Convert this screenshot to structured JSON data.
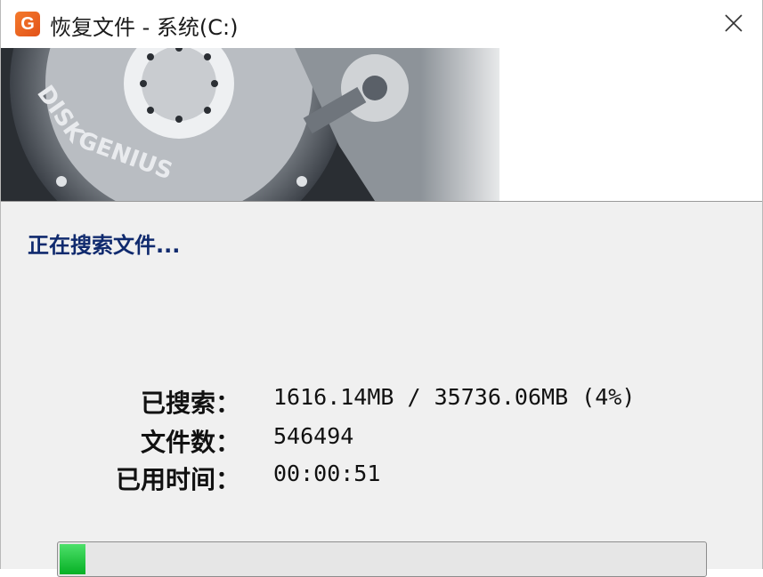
{
  "window": {
    "title": "恢复文件 - 系统(C:)",
    "icon_letter": "G"
  },
  "banner": {
    "brand_text": "DISK GENIUS"
  },
  "status": {
    "message": "正在搜索文件..."
  },
  "stats": [
    {
      "label": "已搜索：",
      "value": "1616.14MB / 35736.06MB (4%)"
    },
    {
      "label": "文件数：",
      "value": "546494"
    },
    {
      "label": "已用时间：",
      "value": "00:00:51"
    }
  ],
  "progress": {
    "fraction": 0.04
  },
  "colors": {
    "status_text": "#102a6e",
    "progress_fill": "#06b025",
    "app_icon": "#e2521a"
  },
  "icons": [
    "diskgenius-logo-icon",
    "close-icon",
    "hard-disk-image"
  ]
}
